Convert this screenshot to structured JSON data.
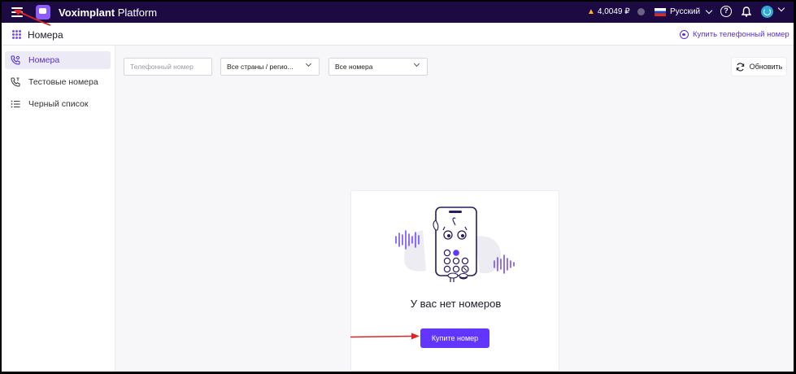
{
  "topbar": {
    "brand_bold": "Voximplant",
    "brand_rest": " Platform",
    "balance": "4,0049 ₽",
    "language": "Русский",
    "help_glyph": "?"
  },
  "page": {
    "title": "Номера",
    "buy_link": "Купить телефонный номер"
  },
  "sidebar": {
    "items": [
      {
        "label": "Номера",
        "icon": "phone-gear-icon",
        "active": true
      },
      {
        "label": "Тестовые номера",
        "icon": "phone-test-icon",
        "active": false
      },
      {
        "label": "Черный список",
        "icon": "list-icon",
        "active": false
      }
    ]
  },
  "filters": {
    "phone_placeholder": "Телефонный номер",
    "country_value": "Все страны / регио...",
    "numbers_value": "Все номера",
    "refresh_label": "Обновить"
  },
  "empty_state": {
    "title": "У вас нет номеров",
    "button_label": "Купите номер"
  },
  "colors": {
    "navbar": "#1c0b42",
    "accent": "#6236ff",
    "annotation_arrow": "#e02424"
  }
}
